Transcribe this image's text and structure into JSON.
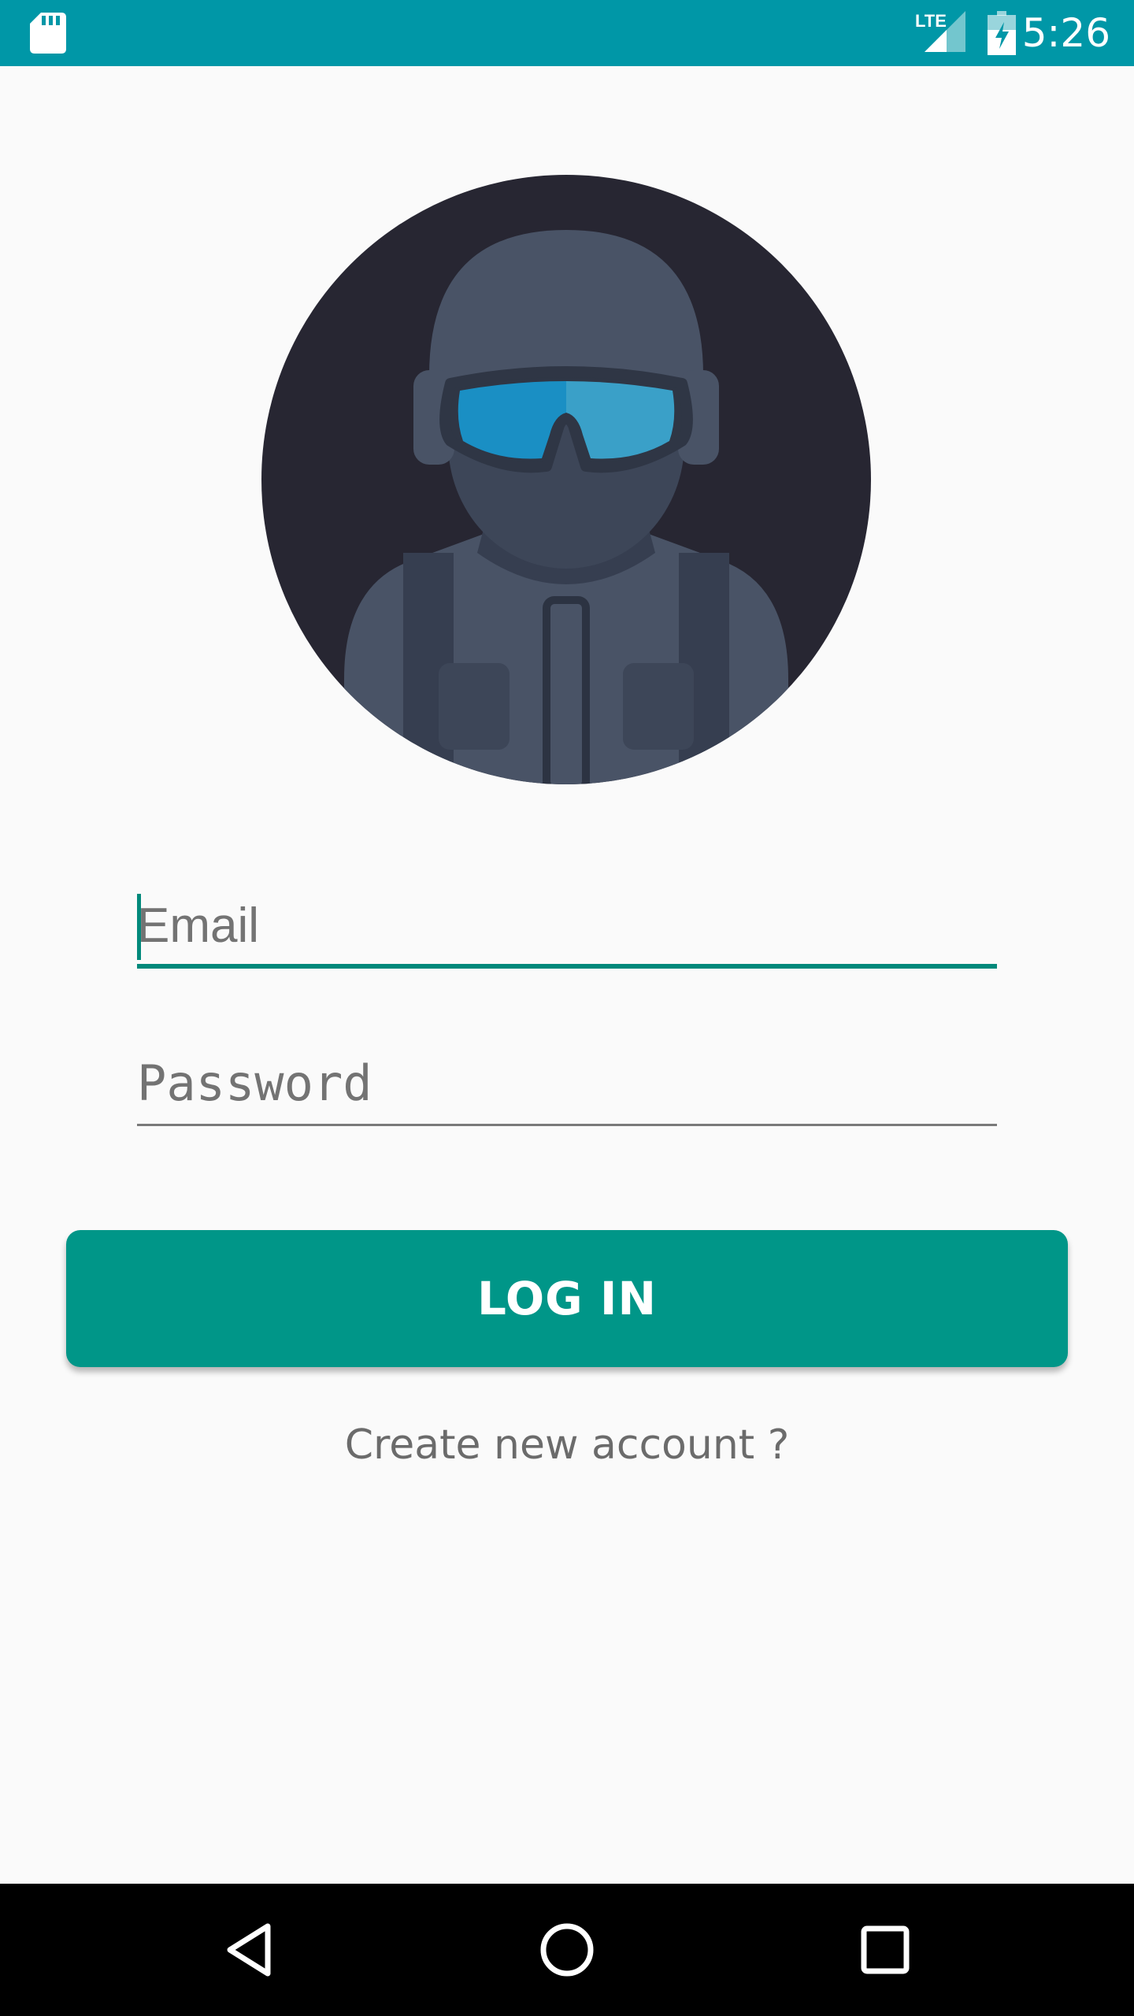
{
  "status_bar": {
    "time": "5:26",
    "network_label": "LTE",
    "background_color": "#0097a7"
  },
  "avatar": {
    "icon": "soldier-avatar-icon",
    "background_color": "#272632",
    "goggles_color": "#1a8fc4"
  },
  "form": {
    "email": {
      "value": "",
      "placeholder": "Email"
    },
    "password": {
      "value": "",
      "placeholder": "Password"
    },
    "accent_color": "#00897b"
  },
  "login_button": {
    "label": "LOG IN",
    "color": "#009688"
  },
  "create_account": {
    "label": "Create new account ?"
  },
  "nav_bar": {
    "back_icon": "back-icon",
    "home_icon": "home-icon",
    "recents_icon": "recents-icon"
  }
}
